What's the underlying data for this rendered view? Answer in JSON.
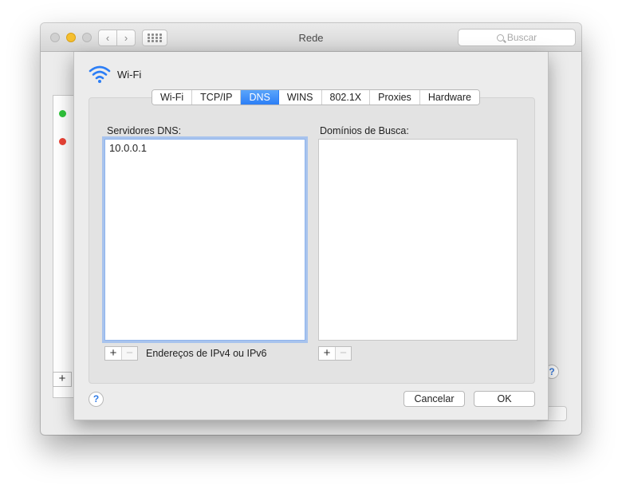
{
  "window": {
    "title": "Rede",
    "search_placeholder": "Buscar"
  },
  "sheet": {
    "interface_name": "Wi-Fi",
    "tabs": [
      {
        "label": "Wi-Fi",
        "active": false
      },
      {
        "label": "TCP/IP",
        "active": false
      },
      {
        "label": "DNS",
        "active": true
      },
      {
        "label": "WINS",
        "active": false
      },
      {
        "label": "802.1X",
        "active": false
      },
      {
        "label": "Proxies",
        "active": false
      },
      {
        "label": "Hardware",
        "active": false
      }
    ],
    "dns_servers_label": "Servidores DNS:",
    "dns_servers": [
      "10.0.0.1"
    ],
    "search_domains_label": "Domínios de Busca:",
    "search_domains": [],
    "add_symbol": "+",
    "remove_symbol": "−",
    "dns_hint": "Endereços de IPv4 ou IPv6",
    "help_symbol": "?",
    "cancel_label": "Cancelar",
    "ok_label": "OK"
  },
  "background": {
    "add_symbol": "+",
    "help_symbol": "?"
  },
  "colors": {
    "accent": "#2c7ef6",
    "status_connected": "#2fc43b",
    "status_disconnected": "#eb4336"
  },
  "icons": {
    "interface": "wifi-icon",
    "search": "search-icon"
  }
}
